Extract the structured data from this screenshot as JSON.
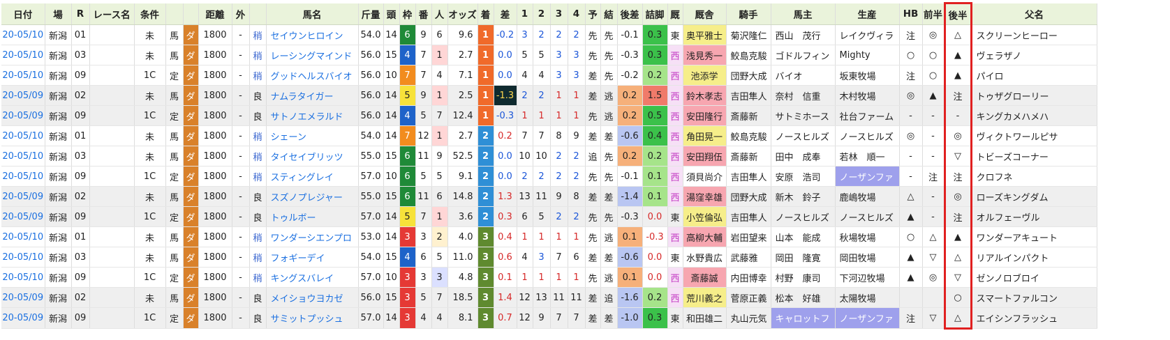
{
  "headers": [
    "日付",
    "場",
    "R",
    "レース名",
    "条件",
    "",
    "",
    "距離",
    "外",
    "",
    "馬名",
    "斤量",
    "頭",
    "枠",
    "番",
    "人",
    "オッズ",
    "着",
    "差",
    "1",
    "2",
    "3",
    "4",
    "予",
    "結",
    "後差",
    "詰脚",
    "厩",
    "厩舎",
    "騎手",
    "馬主",
    "生産",
    "HB",
    "前半",
    "後半",
    "父名"
  ],
  "rows": [
    {
      "date": "20-05/10",
      "track": "新潟",
      "r": "01",
      "race": "",
      "cond": "未",
      "type": "馬",
      "surf": "ダ",
      "dist": "1800",
      "out": "-",
      "going": "稍",
      "horse": "セイウンヒロイン",
      "kin": "54.0",
      "heads": "14",
      "waku": "6",
      "ban": "9",
      "pop": "6",
      "odds": "9.6",
      "fin": "1",
      "diff": "-0.2",
      "c1": "3",
      "c2": "2",
      "c3": "2",
      "c4": "2",
      "yo": "先",
      "res": "先",
      "kosa": "-0.1",
      "zume": "0.3",
      "zoku": "東",
      "trainer": "奥平雅士",
      "jockey": "菊沢隆仁",
      "owner": "西山　茂行",
      "breeder": "レイクヴィラ",
      "hb": "注",
      "zen": "◎",
      "kou": "△",
      "sire": "スクリーンヒーロー"
    },
    {
      "date": "20-05/10",
      "track": "新潟",
      "r": "03",
      "race": "",
      "cond": "未",
      "type": "馬",
      "surf": "ダ",
      "dist": "1800",
      "out": "-",
      "going": "稍",
      "horse": "レーシングマインド",
      "kin": "56.0",
      "heads": "15",
      "waku": "4",
      "ban": "7",
      "pop": "1",
      "odds": "2.7",
      "fin": "1",
      "diff": "0.0",
      "c1": "5",
      "c2": "5",
      "c3": "3",
      "c4": "3",
      "yo": "先",
      "res": "先",
      "kosa": "-0.3",
      "zume": "0.3",
      "zoku": "西",
      "trainer": "浅見秀一",
      "jockey": "鮫島克駿",
      "owner": "ゴドルフィン",
      "breeder": "Mighty",
      "hb": "○",
      "zen": "○",
      "kou": "▲",
      "sire": "ヴェラザノ"
    },
    {
      "date": "20-05/10",
      "track": "新潟",
      "r": "09",
      "race": "",
      "cond": "1C",
      "type": "定",
      "surf": "ダ",
      "dist": "1800",
      "out": "-",
      "going": "稍",
      "horse": "グッドヘルスバイオ",
      "kin": "56.0",
      "heads": "10",
      "waku": "7",
      "ban": "7",
      "pop": "4",
      "odds": "7.1",
      "fin": "1",
      "diff": "0.0",
      "c1": "4",
      "c2": "4",
      "c3": "3",
      "c4": "3",
      "yo": "差",
      "res": "先",
      "kosa": "-0.2",
      "zume": "0.2",
      "zoku": "西",
      "trainer": "池添学",
      "jockey": "団野大成",
      "owner": "バイオ",
      "breeder": "坂東牧場",
      "hb": "注",
      "zen": "○",
      "kou": "▲",
      "sire": "パイロ"
    },
    {
      "date": "20-05/09",
      "track": "新潟",
      "r": "02",
      "race": "",
      "cond": "未",
      "type": "馬",
      "surf": "ダ",
      "dist": "1800",
      "out": "-",
      "going": "良",
      "horse": "ナムラタイガー",
      "kin": "56.0",
      "heads": "14",
      "waku": "5",
      "ban": "9",
      "pop": "1",
      "odds": "2.5",
      "fin": "1",
      "diff": "-1.3",
      "c1": "2",
      "c2": "2",
      "c3": "1",
      "c4": "1",
      "yo": "差",
      "res": "逃",
      "kosa": "0.2",
      "zume": "1.5",
      "zoku": "西",
      "trainer": "鈴木孝志",
      "jockey": "吉田隼人",
      "owner": "奈村　信重",
      "breeder": "木村牧場",
      "hb": "◎",
      "zen": "▲",
      "kou": "注",
      "sire": "トゥザグローリー"
    },
    {
      "date": "20-05/09",
      "track": "新潟",
      "r": "09",
      "race": "",
      "cond": "1C",
      "type": "定",
      "surf": "ダ",
      "dist": "1800",
      "out": "-",
      "going": "良",
      "horse": "サトノエメラルド",
      "kin": "56.0",
      "heads": "14",
      "waku": "4",
      "ban": "5",
      "pop": "7",
      "odds": "12.4",
      "fin": "1",
      "diff": "-0.3",
      "c1": "1",
      "c2": "1",
      "c3": "1",
      "c4": "1",
      "yo": "先",
      "res": "逃",
      "kosa": "0.2",
      "zume": "0.5",
      "zoku": "西",
      "trainer": "安田隆行",
      "jockey": "斎藤新",
      "owner": "サトミホース",
      "breeder": "社台ファーム",
      "hb": "-",
      "zen": "-",
      "kou": "-",
      "sire": "キングカメハメハ"
    },
    {
      "date": "20-05/10",
      "track": "新潟",
      "r": "01",
      "race": "",
      "cond": "未",
      "type": "馬",
      "surf": "ダ",
      "dist": "1800",
      "out": "-",
      "going": "稍",
      "horse": "シェーン",
      "kin": "54.0",
      "heads": "14",
      "waku": "7",
      "ban": "12",
      "pop": "1",
      "odds": "2.7",
      "fin": "2",
      "diff": "0.2",
      "c1": "7",
      "c2": "7",
      "c3": "8",
      "c4": "9",
      "yo": "差",
      "res": "差",
      "kosa": "-0.6",
      "zume": "0.4",
      "zoku": "西",
      "trainer": "角田晃一",
      "jockey": "鮫島克駿",
      "owner": "ノースヒルズ",
      "breeder": "ノースヒルズ",
      "hb": "◎",
      "zen": "-",
      "kou": "◎",
      "sire": "ヴィクトワールピサ"
    },
    {
      "date": "20-05/10",
      "track": "新潟",
      "r": "03",
      "race": "",
      "cond": "未",
      "type": "馬",
      "surf": "ダ",
      "dist": "1800",
      "out": "-",
      "going": "稍",
      "horse": "タイセイブリッツ",
      "kin": "55.0",
      "heads": "15",
      "waku": "6",
      "ban": "11",
      "pop": "9",
      "odds": "52.5",
      "fin": "2",
      "diff": "0.0",
      "c1": "10",
      "c2": "10",
      "c3": "2",
      "c4": "2",
      "yo": "追",
      "res": "先",
      "kosa": "0.2",
      "zume": "0.2",
      "zoku": "西",
      "trainer": "安田翔伍",
      "jockey": "斎藤新",
      "owner": "田中　成奉",
      "breeder": "若林　順一",
      "hb": "-",
      "zen": "-",
      "kou": "▽",
      "sire": "トビーズコーナー"
    },
    {
      "date": "20-05/10",
      "track": "新潟",
      "r": "09",
      "race": "",
      "cond": "1C",
      "type": "定",
      "surf": "ダ",
      "dist": "1800",
      "out": "-",
      "going": "稍",
      "horse": "スティングレイ",
      "kin": "57.0",
      "heads": "10",
      "waku": "6",
      "ban": "5",
      "pop": "5",
      "odds": "9.1",
      "fin": "2",
      "diff": "0.0",
      "c1": "2",
      "c2": "2",
      "c3": "2",
      "c4": "2",
      "yo": "先",
      "res": "先",
      "kosa": "-0.1",
      "zume": "0.1",
      "zoku": "西",
      "trainer": "須貝尚介",
      "jockey": "吉田隼人",
      "owner": "安原　浩司",
      "breeder": "ノーザンファ",
      "hb": "-",
      "zen": "注",
      "kou": "注",
      "sire": "クロフネ"
    },
    {
      "date": "20-05/09",
      "track": "新潟",
      "r": "02",
      "race": "",
      "cond": "未",
      "type": "馬",
      "surf": "ダ",
      "dist": "1800",
      "out": "-",
      "going": "良",
      "horse": "スズノプレジャー",
      "kin": "55.0",
      "heads": "15",
      "waku": "6",
      "ban": "11",
      "pop": "6",
      "odds": "14.8",
      "fin": "2",
      "diff": "1.3",
      "c1": "13",
      "c2": "11",
      "c3": "9",
      "c4": "8",
      "yo": "差",
      "res": "差",
      "kosa": "-1.4",
      "zume": "0.1",
      "zoku": "西",
      "trainer": "湯窪幸雄",
      "jockey": "団野大成",
      "owner": "新木　鈴子",
      "breeder": "鹿嶋牧場",
      "hb": "△",
      "zen": "-",
      "kou": "◎",
      "sire": "ローズキングダム"
    },
    {
      "date": "20-05/09",
      "track": "新潟",
      "r": "09",
      "race": "",
      "cond": "1C",
      "type": "定",
      "surf": "ダ",
      "dist": "1800",
      "out": "-",
      "going": "良",
      "horse": "トゥルボー",
      "kin": "57.0",
      "heads": "14",
      "waku": "5",
      "ban": "7",
      "pop": "1",
      "odds": "3.6",
      "fin": "2",
      "diff": "0.3",
      "c1": "6",
      "c2": "5",
      "c3": "2",
      "c4": "2",
      "yo": "先",
      "res": "先",
      "kosa": "-0.3",
      "zume": "0.0",
      "zoku": "東",
      "trainer": "小笠倫弘",
      "jockey": "吉田隼人",
      "owner": "ノースヒルズ",
      "breeder": "ノースヒルズ",
      "hb": "▲",
      "zen": "-",
      "kou": "注",
      "sire": "オルフェーヴル"
    },
    {
      "date": "20-05/10",
      "track": "新潟",
      "r": "01",
      "race": "",
      "cond": "未",
      "type": "馬",
      "surf": "ダ",
      "dist": "1800",
      "out": "-",
      "going": "稍",
      "horse": "ワンダーシエンプロ",
      "kin": "53.0",
      "heads": "14",
      "waku": "3",
      "ban": "3",
      "pop": "2",
      "odds": "4.0",
      "fin": "3",
      "diff": "0.4",
      "c1": "1",
      "c2": "1",
      "c3": "1",
      "c4": "1",
      "yo": "先",
      "res": "逃",
      "kosa": "0.1",
      "zume": "-0.3",
      "zoku": "西",
      "trainer": "高柳大輔",
      "jockey": "岩田望来",
      "owner": "山本　能成",
      "breeder": "秋場牧場",
      "hb": "○",
      "zen": "△",
      "kou": "▲",
      "sire": "ワンダーアキュート"
    },
    {
      "date": "20-05/10",
      "track": "新潟",
      "r": "03",
      "race": "",
      "cond": "未",
      "type": "馬",
      "surf": "ダ",
      "dist": "1800",
      "out": "-",
      "going": "稍",
      "horse": "フォギーデイ",
      "kin": "54.0",
      "heads": "15",
      "waku": "4",
      "ban": "6",
      "pop": "5",
      "odds": "11.0",
      "fin": "3",
      "diff": "0.6",
      "c1": "4",
      "c2": "3",
      "c3": "7",
      "c4": "6",
      "yo": "差",
      "res": "差",
      "kosa": "-0.6",
      "zume": "0.0",
      "zoku": "東",
      "trainer": "水野貴広",
      "jockey": "武藤雅",
      "owner": "岡田　隆寛",
      "breeder": "岡田牧場",
      "hb": "▲",
      "zen": "▽",
      "kou": "△",
      "sire": "リアルインパクト"
    },
    {
      "date": "20-05/10",
      "track": "新潟",
      "r": "09",
      "race": "",
      "cond": "1C",
      "type": "定",
      "surf": "ダ",
      "dist": "1800",
      "out": "-",
      "going": "稍",
      "horse": "キングスバレイ",
      "kin": "57.0",
      "heads": "10",
      "waku": "3",
      "ban": "3",
      "pop": "3",
      "odds": "4.8",
      "fin": "3",
      "diff": "0.1",
      "c1": "1",
      "c2": "1",
      "c3": "1",
      "c4": "1",
      "yo": "先",
      "res": "逃",
      "kosa": "0.1",
      "zume": "0.0",
      "zoku": "西",
      "trainer": "斎藤誠",
      "jockey": "内田博幸",
      "owner": "村野　康司",
      "breeder": "下河辺牧場",
      "hb": "▲",
      "zen": "◎",
      "kou": "▽",
      "sire": "ゼンノロブロイ"
    },
    {
      "date": "20-05/09",
      "track": "新潟",
      "r": "02",
      "race": "",
      "cond": "未",
      "type": "馬",
      "surf": "ダ",
      "dist": "1800",
      "out": "-",
      "going": "良",
      "horse": "メイショウヨカゼ",
      "kin": "56.0",
      "heads": "15",
      "waku": "3",
      "ban": "5",
      "pop": "7",
      "odds": "18.5",
      "fin": "3",
      "diff": "1.4",
      "c1": "12",
      "c2": "13",
      "c3": "11",
      "c4": "11",
      "yo": "差",
      "res": "追",
      "kosa": "-1.6",
      "zume": "0.2",
      "zoku": "西",
      "trainer": "荒川義之",
      "jockey": "菅原正義",
      "owner": "松本　好雄",
      "breeder": "太陽牧場",
      "hb": "",
      "zen": "",
      "kou": "○",
      "sire": "スマートファルコン"
    },
    {
      "date": "20-05/09",
      "track": "新潟",
      "r": "09",
      "race": "",
      "cond": "1C",
      "type": "定",
      "surf": "ダ",
      "dist": "1800",
      "out": "-",
      "going": "良",
      "horse": "サミットプッシュ",
      "kin": "57.0",
      "heads": "14",
      "waku": "3",
      "ban": "4",
      "pop": "4",
      "odds": "8.1",
      "fin": "3",
      "diff": "0.7",
      "c1": "12",
      "c2": "9",
      "c3": "7",
      "c4": "7",
      "yo": "差",
      "res": "差",
      "kosa": "-1.0",
      "zume": "0.3",
      "zoku": "東",
      "trainer": "和田雄二",
      "jockey": "丸山元気",
      "owner": "キャロットフ",
      "breeder": "ノーザンファ",
      "hb": "注",
      "zen": "▽",
      "kou": "△",
      "sire": "エイシンフラッシュ"
    }
  ],
  "colors": {
    "header_bg": "#eaf3db",
    "link": "#1a6fe0",
    "highlight_border": "#e02020"
  }
}
